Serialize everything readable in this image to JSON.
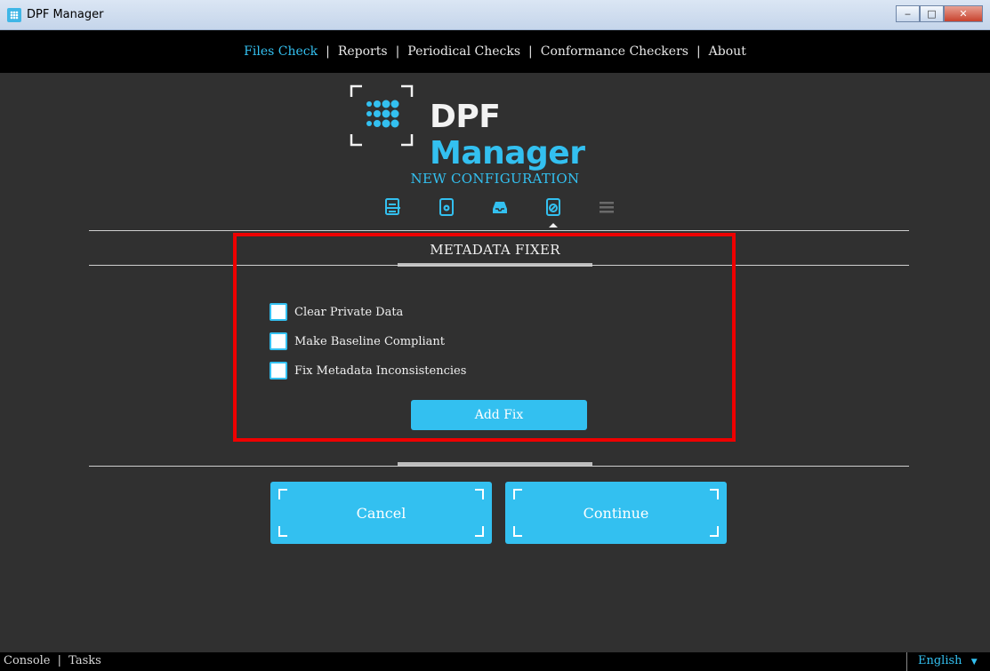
{
  "window": {
    "title": "DPF Manager",
    "minimize": "‒",
    "maximize": "□",
    "close": "✕"
  },
  "nav": {
    "items": [
      {
        "label": "Files Check",
        "active": true
      },
      {
        "label": "Reports",
        "active": false
      },
      {
        "label": "Periodical Checks",
        "active": false
      },
      {
        "label": "Conformance Checkers",
        "active": false
      },
      {
        "label": "About",
        "active": false
      }
    ],
    "separator": "|"
  },
  "logo": {
    "word1": "DPF",
    "word2": "Manager"
  },
  "section_title": "NEW CONFIGURATION",
  "steps": [
    {
      "icon": "document-list-icon"
    },
    {
      "icon": "document-gear-icon"
    },
    {
      "icon": "inbox-tray-icon"
    },
    {
      "icon": "document-wrench-icon",
      "current": true
    },
    {
      "icon": "list-lines-icon",
      "disabled": true
    }
  ],
  "panel": {
    "title": "METADATA FIXER",
    "options": [
      {
        "label": "Clear Private Data",
        "checked": false
      },
      {
        "label": "Make Baseline Compliant",
        "checked": false
      },
      {
        "label": "Fix Metadata Inconsistencies",
        "checked": false
      }
    ],
    "add_fix_label": "Add Fix"
  },
  "buttons": {
    "cancel": "Cancel",
    "continue": "Continue"
  },
  "status": {
    "console": "Console",
    "tasks": "Tasks",
    "separator": "|",
    "language": "English"
  },
  "colors": {
    "accent": "#33c0f0",
    "background": "#303030",
    "highlight": "#ee0000"
  }
}
